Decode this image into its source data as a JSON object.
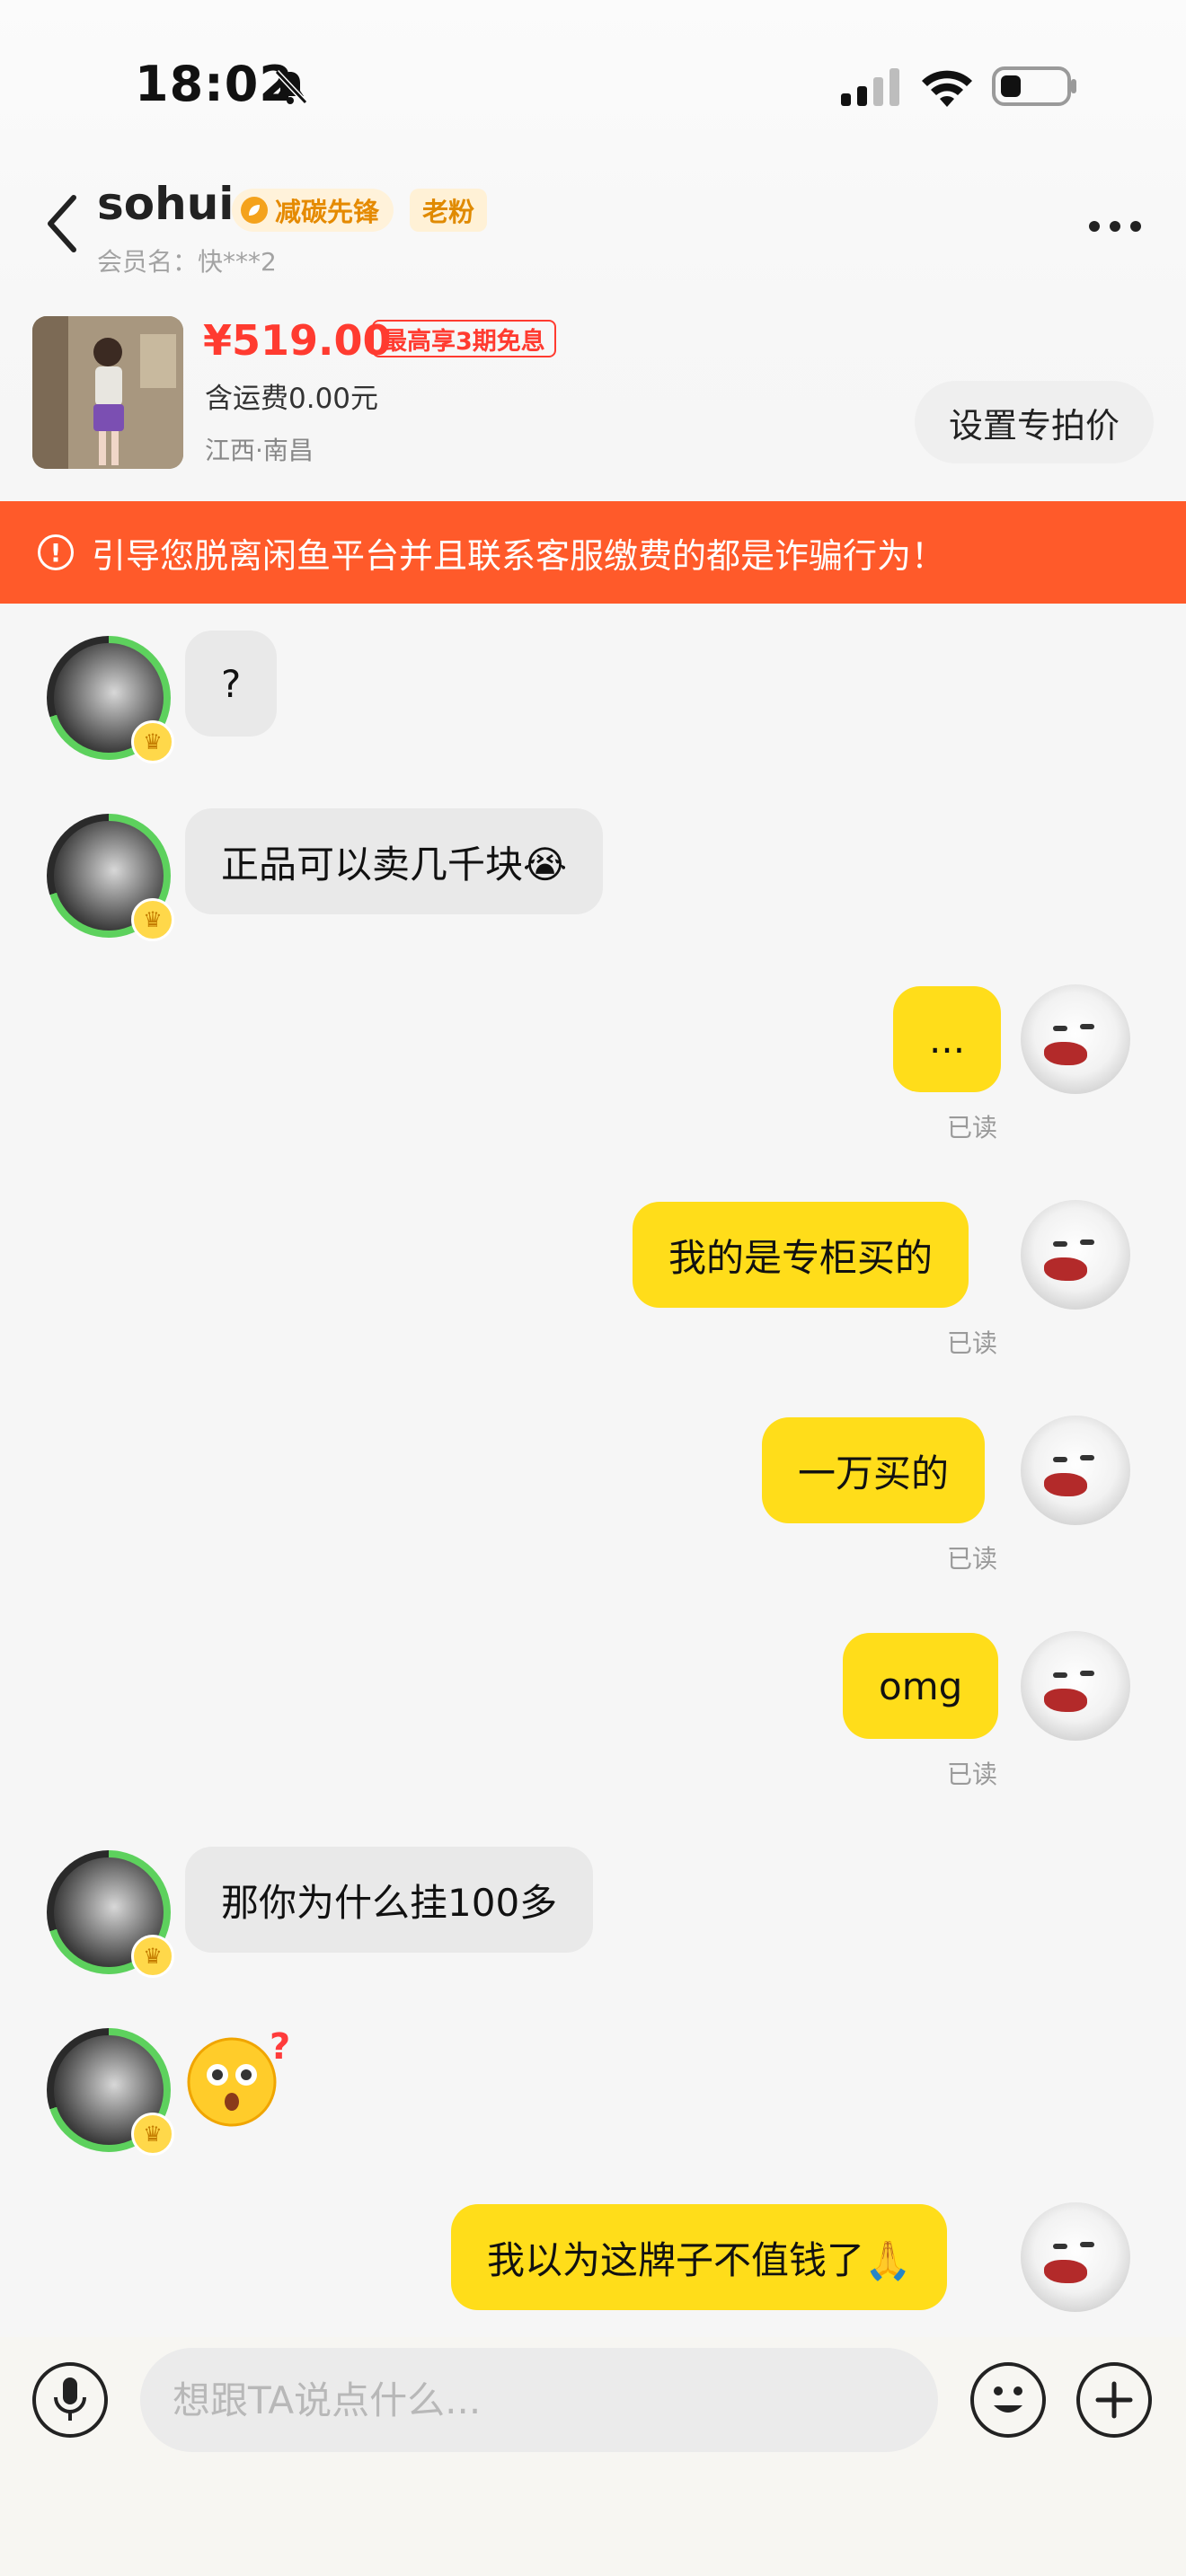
{
  "status_bar": {
    "time": "18:02"
  },
  "header": {
    "user_name": "sohui",
    "badge_carbon": "减碳先锋",
    "badge_fan": "老粉",
    "member_name": "会员名：快***2"
  },
  "product": {
    "price": "¥519.00",
    "installment": "最高享3期免息",
    "shipping": "含运费0.00元",
    "location": "江西·南昌",
    "special_price_button": "设置专拍价"
  },
  "warning": {
    "text": "引导您脱离闲鱼平台并且联系客服缴费的都是诈骗行为！"
  },
  "messages": [
    {
      "side": "in",
      "text": "?"
    },
    {
      "side": "in",
      "text": "正品可以卖几千块😭"
    },
    {
      "side": "out",
      "text": "...",
      "status": "已读"
    },
    {
      "side": "out",
      "text": "我的是专柜买的",
      "status": "已读"
    },
    {
      "side": "out",
      "text": "一万买的",
      "status": "已读"
    },
    {
      "side": "out",
      "text": "omg",
      "status": "已读"
    },
    {
      "side": "in",
      "text": "那你为什么挂100多"
    },
    {
      "side": "in",
      "text": "",
      "sticker": "confused-face-emoji"
    },
    {
      "side": "out",
      "text": "我以为这牌子不值钱了🙏"
    }
  ],
  "input": {
    "placeholder": "想跟TA说点什么..."
  },
  "icons": {
    "back": "chevron-left-icon",
    "more": "more-dots-icon",
    "mic": "microphone-icon",
    "emoji": "smiley-icon",
    "plus": "plus-icon",
    "bell_muted": "bell-slash-icon"
  },
  "colors": {
    "accent_yellow": "#ffdd1a",
    "price_red": "#ff3b30",
    "warning_orange": "#ff5a2a"
  }
}
